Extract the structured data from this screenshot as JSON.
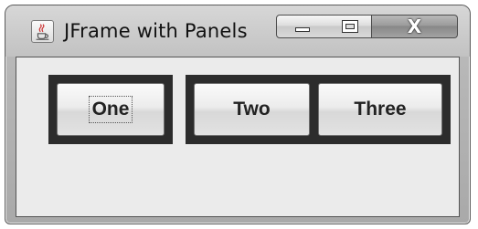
{
  "window": {
    "title": "JFrame with Panels",
    "icon": "java-coffee-cup-icon",
    "controls": {
      "minimize": "minimize-icon",
      "maximize": "maximize-icon",
      "close_label": "X"
    }
  },
  "panels": [
    {
      "buttons": [
        {
          "label": "One",
          "focused": true
        }
      ]
    },
    {
      "buttons": [
        {
          "label": "Two"
        },
        {
          "label": "Three"
        }
      ]
    }
  ],
  "colors": {
    "panel_background": "#2c2c2c",
    "content_background": "#ebebeb"
  }
}
